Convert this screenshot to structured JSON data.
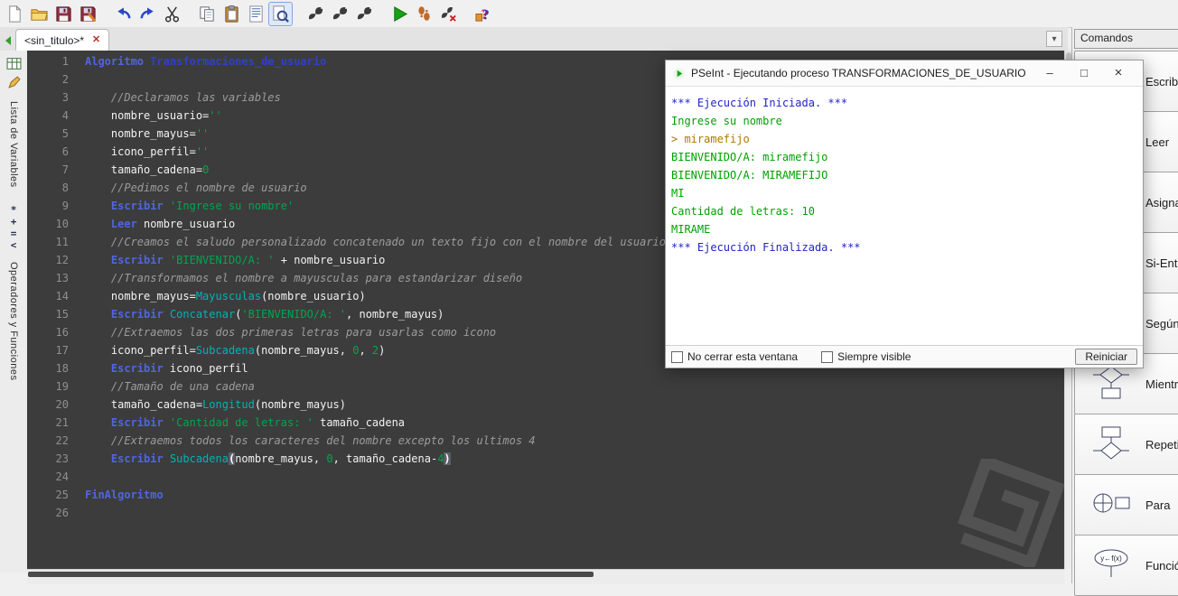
{
  "colors": {
    "editor_bg": "#3c3c3c",
    "keyword": "#4f66e0",
    "process_name": "#2e3fd4",
    "identifier": "#f2f2f2",
    "string": "#00a650",
    "comment": "#9c9c9c",
    "function": "#00b4b4",
    "number": "#00a650",
    "console_system": "#2222cc",
    "console_output": "#00a000",
    "console_input": "#b07800",
    "run_green": "#18a018"
  },
  "toolbar": {
    "pressed": "search",
    "groups": [
      [
        "new-file",
        "open-folder",
        "save",
        "save-as"
      ],
      [
        "undo",
        "redo",
        "cut"
      ],
      [
        "copy",
        "paste",
        "text-columns",
        "search"
      ],
      [
        "flowchart-a",
        "flowchart-b",
        "flowchart-c"
      ],
      [
        "run",
        "run-step",
        "run-debug"
      ],
      [
        "help"
      ]
    ]
  },
  "tabs": {
    "active_label": "<sin_titulo>*"
  },
  "left_sidebar": {
    "top_icons": [
      "variables-table-icon",
      "edit-pencil-icon"
    ],
    "tab_variables": "Lista de Variables",
    "operator_symbols": "*+=<",
    "tab_operators": "Operadores y Funciones"
  },
  "editor": {
    "lines": [
      [
        [
          "kw",
          "Algoritmo"
        ],
        [
          "pl",
          " "
        ],
        [
          "proc",
          "Transformaciones_de_usuario"
        ]
      ],
      [],
      [
        [
          "com",
          "    //Declaramos las variables"
        ]
      ],
      [
        [
          "pl",
          "    nombre_usuario"
        ],
        [
          "op",
          "="
        ],
        [
          "str",
          "''"
        ]
      ],
      [
        [
          "pl",
          "    nombre_mayus"
        ],
        [
          "op",
          "="
        ],
        [
          "str",
          "''"
        ]
      ],
      [
        [
          "pl",
          "    icono_perfil"
        ],
        [
          "op",
          "="
        ],
        [
          "str",
          "''"
        ]
      ],
      [
        [
          "pl",
          "    tamaño_cadena"
        ],
        [
          "op",
          "="
        ],
        [
          "num",
          "0"
        ]
      ],
      [
        [
          "com",
          "    //Pedimos el nombre de usuario"
        ]
      ],
      [
        [
          "pl",
          "    "
        ],
        [
          "kw",
          "Escribir"
        ],
        [
          "pl",
          " "
        ],
        [
          "str",
          "'Ingrese su nombre'"
        ]
      ],
      [
        [
          "pl",
          "    "
        ],
        [
          "kw",
          "Leer"
        ],
        [
          "pl",
          " nombre_usuario"
        ]
      ],
      [
        [
          "com",
          "    //Creamos el saludo personalizado concatenado un texto fijo con el nombre del usuario"
        ]
      ],
      [
        [
          "pl",
          "    "
        ],
        [
          "kw",
          "Escribir"
        ],
        [
          "pl",
          " "
        ],
        [
          "str",
          "'BIENVENIDO/A: '"
        ],
        [
          "pl",
          " "
        ],
        [
          "op",
          "+"
        ],
        [
          "pl",
          " nombre_usuario"
        ]
      ],
      [
        [
          "com",
          "    //Transformamos el nombre a mayusculas para estandarizar diseño"
        ]
      ],
      [
        [
          "pl",
          "    nombre_mayus"
        ],
        [
          "op",
          "="
        ],
        [
          "fn",
          "Mayusculas"
        ],
        [
          "pl",
          "(nombre_usuario)"
        ]
      ],
      [
        [
          "pl",
          "    "
        ],
        [
          "kw",
          "Escribir"
        ],
        [
          "pl",
          " "
        ],
        [
          "fn",
          "Concatenar"
        ],
        [
          "pl",
          "("
        ],
        [
          "str",
          "'BIENVENIDO/A: '"
        ],
        [
          "pl",
          ", nombre_mayus)"
        ]
      ],
      [
        [
          "com",
          "    //Extraemos las dos primeras letras para usarlas como icono"
        ]
      ],
      [
        [
          "pl",
          "    icono_perfil"
        ],
        [
          "op",
          "="
        ],
        [
          "fn",
          "Subcadena"
        ],
        [
          "pl",
          "(nombre_mayus, "
        ],
        [
          "num",
          "0"
        ],
        [
          "pl",
          ", "
        ],
        [
          "num",
          "2"
        ],
        [
          "pl",
          ")"
        ]
      ],
      [
        [
          "pl",
          "    "
        ],
        [
          "kw",
          "Escribir"
        ],
        [
          "pl",
          " icono_perfil"
        ]
      ],
      [
        [
          "com",
          "    //Tamaño de una cadena"
        ]
      ],
      [
        [
          "pl",
          "    tamaño_cadena"
        ],
        [
          "op",
          "="
        ],
        [
          "fn",
          "Longitud"
        ],
        [
          "pl",
          "(nombre_mayus)"
        ]
      ],
      [
        [
          "pl",
          "    "
        ],
        [
          "kw",
          "Escribir"
        ],
        [
          "pl",
          " "
        ],
        [
          "str",
          "'Cantidad de letras: '"
        ],
        [
          "pl",
          " tamaño_cadena"
        ]
      ],
      [
        [
          "com",
          "    //Extraemos todos los caracteres del nombre excepto los ultimos 4"
        ]
      ],
      [
        [
          "pl",
          "    "
        ],
        [
          "kw",
          "Escribir"
        ],
        [
          "pl",
          " "
        ],
        [
          "fn",
          "Subcadena"
        ],
        [
          "hl",
          "("
        ],
        [
          "pl",
          "nombre_mayus, "
        ],
        [
          "num",
          "0"
        ],
        [
          "pl",
          ", tamaño_cadena-"
        ],
        [
          "num",
          "4"
        ],
        [
          "hl",
          ")"
        ]
      ],
      [],
      [
        [
          "kw",
          "FinAlgoritmo"
        ]
      ],
      []
    ]
  },
  "exec_window": {
    "title": "PSeInt - Ejecutando proceso TRANSFORMACIONES_DE_USUARIO",
    "controls": [
      "minimize",
      "maximize",
      "close"
    ],
    "console": [
      {
        "type": "sys",
        "text": "*** Ejecución Iniciada. ***"
      },
      {
        "type": "out",
        "text": "Ingrese su nombre"
      },
      {
        "type": "in",
        "text": "> miramefijo"
      },
      {
        "type": "out",
        "text": "BIENVENIDO/A: miramefijo"
      },
      {
        "type": "out",
        "text": "BIENVENIDO/A: MIRAMEFIJO"
      },
      {
        "type": "out",
        "text": "MI"
      },
      {
        "type": "out",
        "text": "Cantidad de letras: 10"
      },
      {
        "type": "out",
        "text": "MIRAME"
      },
      {
        "type": "sys",
        "text": "*** Ejecución Finalizada. ***"
      }
    ],
    "footer": {
      "checkbox_no_cerrar": "No cerrar esta ventana",
      "checkbox_siempre": "Siempre visible",
      "restart_button": "Reiniciar"
    }
  },
  "commands_panel": {
    "title": "Comandos",
    "items": [
      {
        "label": "Escribir",
        "icon": "write"
      },
      {
        "label": "Leer",
        "icon": "read"
      },
      {
        "label": "Asignar",
        "icon": "assign"
      },
      {
        "label": "Si-Entonces",
        "icon": "if"
      },
      {
        "label": "Según",
        "icon": "switch"
      },
      {
        "label": "Mientras",
        "icon": "while"
      },
      {
        "label": "Repetir",
        "icon": "repeat"
      },
      {
        "label": "Para",
        "icon": "for"
      },
      {
        "label": "Función",
        "icon": "function"
      }
    ]
  },
  "watermark_icon": "platzi-logo"
}
